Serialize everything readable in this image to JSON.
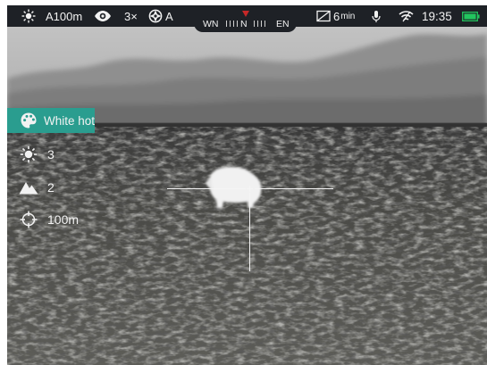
{
  "status_bar": {
    "range_icon": "sun-burst-icon",
    "range": "A100m",
    "eye_icon": "eye-icon",
    "zoom": "3×",
    "mode_icon": "auto-calibration-icon",
    "mode": "A",
    "timer_icon": "shutdown-timer-icon",
    "timer_value": "6",
    "timer_unit": "min",
    "mic_icon": "microphone-icon",
    "wifi_icon": "wifi-icon",
    "time": "19:35",
    "battery_icon": "battery-icon",
    "battery_color": "#22c55e"
  },
  "compass": {
    "left": "WN",
    "center": "N",
    "right": "EN",
    "pointer_color": "#c62828"
  },
  "menu": {
    "palette": {
      "icon": "palette-icon",
      "label": "White hot",
      "highlight_color": "#2a9d8f"
    },
    "brightness": {
      "icon": "brightness-icon",
      "value": "3"
    },
    "contrast": {
      "icon": "contrast-icon",
      "value": "2"
    },
    "rangefinder": {
      "icon": "crosshair-icon",
      "value": "100m"
    }
  }
}
